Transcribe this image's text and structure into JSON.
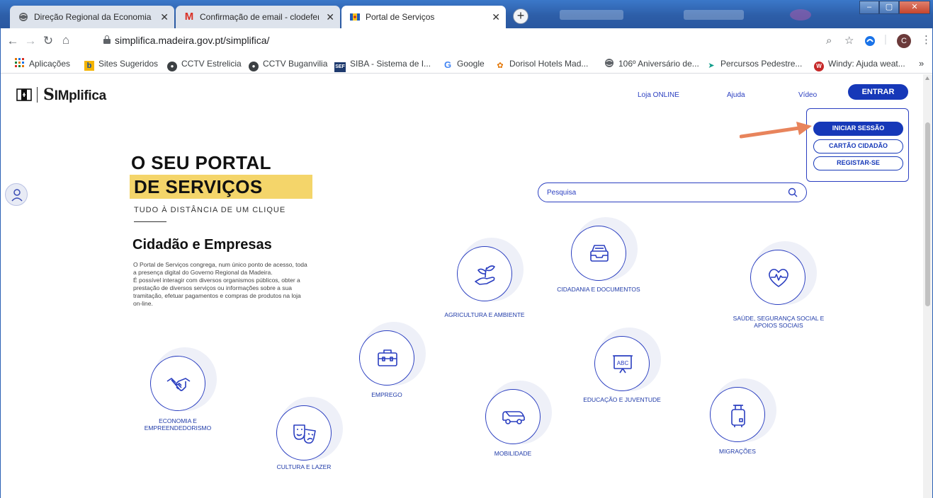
{
  "browser": {
    "tabs": [
      {
        "title": "Direção Regional da Economia e",
        "favicon": "globe-icon",
        "active": false
      },
      {
        "title": "Confirmação de email - clodefer",
        "favicon": "gmail-icon",
        "active": false
      },
      {
        "title": "Portal de Serviços",
        "favicon": "madeira-flag-icon",
        "active": true
      }
    ],
    "new_tab": "+",
    "url": "simplifica.madeira.gov.pt/simplifica/",
    "avatar_letter": "C",
    "bookmarks": [
      {
        "label": "Aplicações",
        "icon": "apps-grid-icon"
      },
      {
        "label": "Sites Sugeridos",
        "icon": "bing-icon"
      },
      {
        "label": "CCTV Estrelicia",
        "icon": "camera-icon"
      },
      {
        "label": "CCTV Buganvilia",
        "icon": "camera-icon"
      },
      {
        "label": "SIBA - Sistema de I...",
        "icon": "sef-icon"
      },
      {
        "label": "Google",
        "icon": "google-icon"
      },
      {
        "label": "Dorisol Hotels Mad...",
        "icon": "dorisol-icon"
      },
      {
        "label": "106º Aniversário de...",
        "icon": "globe-icon"
      },
      {
        "label": "Percursos Pedestre...",
        "icon": "trail-icon"
      },
      {
        "label": "Windy: Ajuda weat...",
        "icon": "windy-icon"
      }
    ],
    "bookmarks_overflow": "»"
  },
  "site": {
    "brand": "IMplifica",
    "brand_initial": "S",
    "nav": {
      "loja": "Loja ONLINE",
      "ajuda": "Ajuda",
      "video": "Vídeo",
      "entrar": "ENTRAR"
    },
    "login": {
      "iniciar": "INICIAR SESSÃO",
      "cartao": "CARTÃO CIDADÃO",
      "registar": "REGISTAR-SE"
    },
    "hero": {
      "line1": "O SEU PORTAL",
      "line2": "DE SERVIÇOS",
      "subtitle": "TUDO À DISTÂNCIA DE UM CLIQUE"
    },
    "section": {
      "title": "Cidadão e Empresas",
      "paragraphs": [
        "O Portal de Serviços congrega, num único ponto de acesso, toda a presença digital do Governo Regional da Madeira.",
        "É possível interagir com diversos organismos públicos, obter a prestação de diversos serviços ou informações sobre a sua tramitação, efetuar pagamentos e compras de produtos na loja on-line."
      ]
    },
    "search": {
      "placeholder": "Pesquisa"
    },
    "categories": [
      {
        "label": "Agricultura e Ambiente",
        "icon": "plant-hand-icon"
      },
      {
        "label": "Cidadania e Documentos",
        "icon": "document-tray-icon"
      },
      {
        "label": "Saúde, Segurança Social e Apoios Sociais",
        "icon": "heart-pulse-icon"
      },
      {
        "label": "Emprego",
        "icon": "briefcase-icon"
      },
      {
        "label": "Educação e Juventude",
        "icon": "presentation-board-icon"
      },
      {
        "label": "Economia e Empreendedorismo",
        "icon": "handshake-icon"
      },
      {
        "label": "Cultura e Lazer",
        "icon": "theater-masks-icon"
      },
      {
        "label": "Mobilidade",
        "icon": "car-icon"
      },
      {
        "label": "Migrações",
        "icon": "luggage-icon"
      }
    ],
    "colors": {
      "accent": "#1638b8",
      "highlight": "#f4d56a",
      "pointer_arrow": "#e8845c"
    }
  }
}
